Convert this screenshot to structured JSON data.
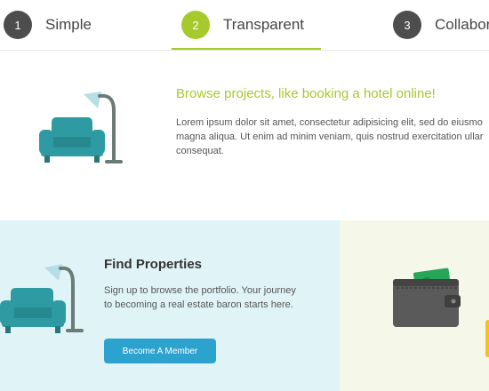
{
  "tabs": [
    {
      "number": "1",
      "label": "Simple"
    },
    {
      "number": "2",
      "label": "Transparent"
    },
    {
      "number": "3",
      "label": "Collabor"
    }
  ],
  "hero": {
    "title": "Browse projects, like booking a hotel online!",
    "text": "Lorem ipsum dolor sit amet, consectetur adipisicing elit, sed do eiusmo\nmagna aliqua. Ut enim ad minim veniam, quis nostrud exercitation ullar\nconsequat."
  },
  "find": {
    "title": "Find Properties",
    "text": "Sign up to browse the portfolio. Your journey to becoming a real estate baron starts here.",
    "button_label": "Become A Member"
  },
  "colors": {
    "accent_green": "#a6c92c",
    "button_blue": "#2ca3cf",
    "panel_blue": "#e0f4f8",
    "panel_green": "#f5f7e9",
    "armchair": "#2e9ba3"
  },
  "icons": [
    "armchair-lamp-icon",
    "wallet-icon"
  ]
}
